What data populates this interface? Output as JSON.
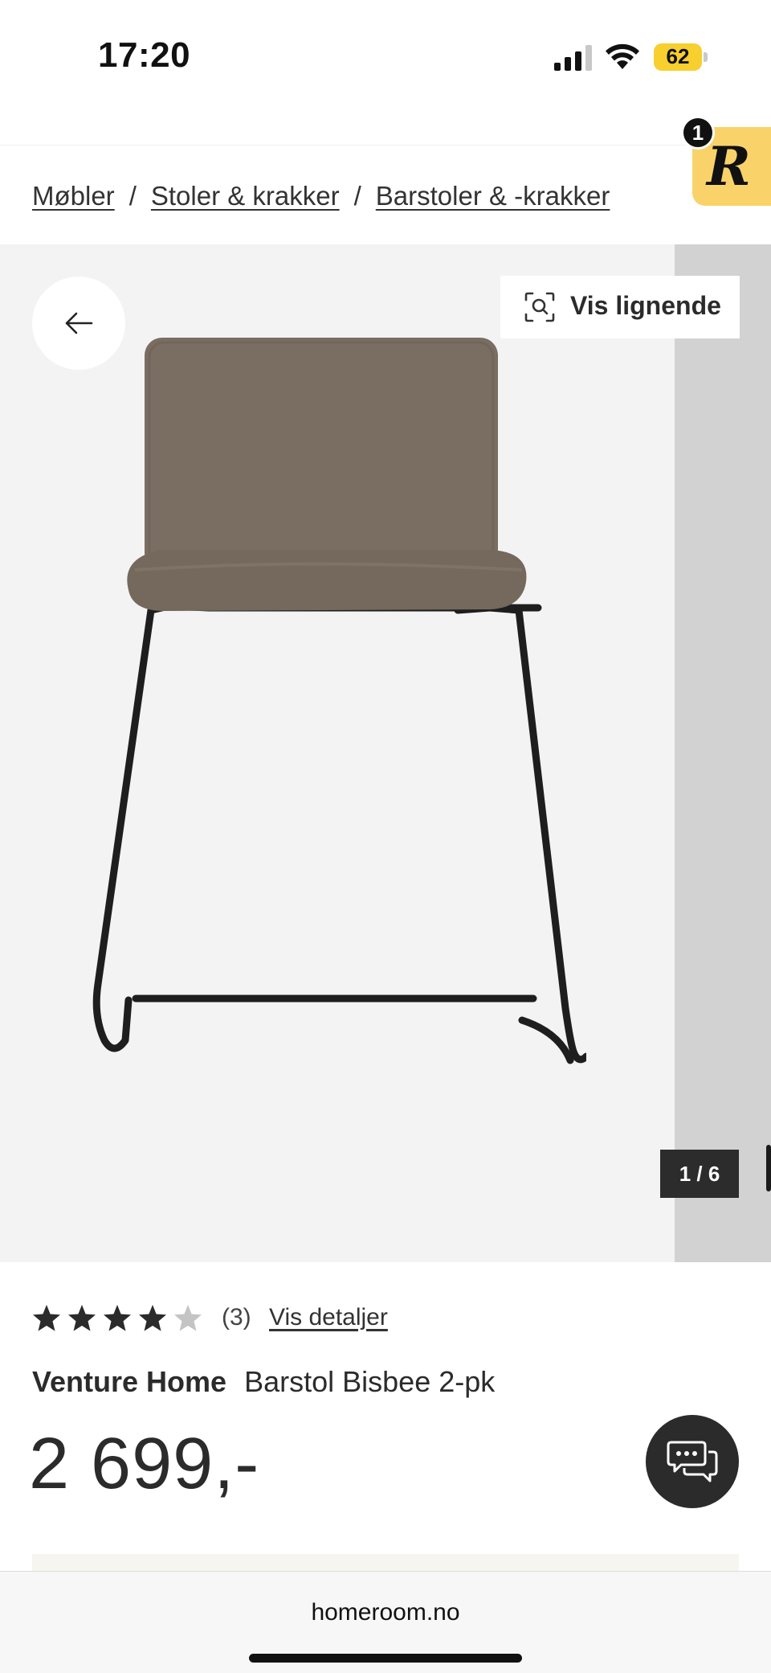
{
  "status_bar": {
    "time": "17:20",
    "battery_level": "62",
    "signal_icon": "cellular-signal-icon",
    "wifi_icon": "wifi-icon",
    "battery_color": "#f7cf2e"
  },
  "breadcrumb": {
    "items": [
      "Møbler",
      "Stoler & krakker",
      "Barstoler & -krakker"
    ],
    "separator": "/"
  },
  "widget": {
    "letter": "R",
    "badge_count": "1",
    "color": "#f9d36a"
  },
  "gallery": {
    "back_icon": "arrow-left-icon",
    "similar_icon": "visual-search-icon",
    "similar_label": "Vis lignende",
    "counter": "1 / 6"
  },
  "product": {
    "rating": 4,
    "rating_max": 5,
    "rating_count": "(3)",
    "details_link": "Vis detaljer",
    "brand": "Venture Home",
    "name": "Barstol Bisbee 2-pk",
    "price": "2 699,-"
  },
  "chat": {
    "icon": "chat-bubbles-icon"
  },
  "browser": {
    "url": "homeroom.no"
  }
}
